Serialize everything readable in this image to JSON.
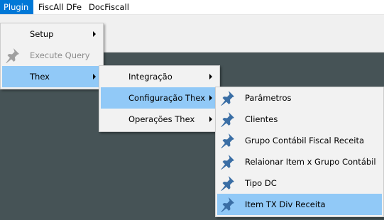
{
  "menubar": {
    "items": [
      {
        "label": "Plugin",
        "active": true
      },
      {
        "label": "FiscAll DFe"
      },
      {
        "label": "DocFiscall"
      }
    ]
  },
  "plugin_menu": {
    "items": [
      {
        "label": "Setup",
        "submenu": true
      },
      {
        "label": "Execute Query",
        "disabled": true,
        "icon": "pin-icon"
      },
      {
        "label": "Thex",
        "submenu": true,
        "highlighted": true
      }
    ]
  },
  "thex_menu": {
    "items": [
      {
        "label": "Integração",
        "submenu": true
      },
      {
        "label": "Configuração Thex",
        "submenu": true,
        "highlighted": true
      },
      {
        "label": "Operações Thex",
        "submenu": true
      }
    ]
  },
  "config_menu": {
    "items": [
      {
        "label": "Parâmetros",
        "icon": "pin-icon"
      },
      {
        "label": "Clientes",
        "icon": "pin-icon"
      },
      {
        "label": "Grupo Contábil Fiscal Receita",
        "icon": "pin-icon"
      },
      {
        "label": "Relaionar Item x Grupo Contábil",
        "icon": "pin-icon"
      },
      {
        "label": "Tipo DC",
        "icon": "pin-icon"
      },
      {
        "label": "Item TX Div Receita",
        "icon": "pin-icon",
        "highlighted": true
      }
    ]
  },
  "colors": {
    "menubar_active": "#0078d7",
    "menu_highlight": "#91c9f7",
    "workspace": "#465356",
    "pin_blue": "#3a6ea5",
    "pin_disabled": "#a0a0a0"
  }
}
